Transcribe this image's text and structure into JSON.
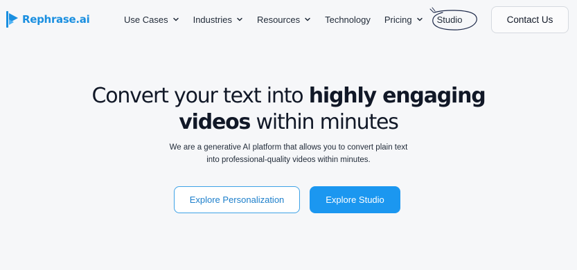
{
  "brand": {
    "name": "Rephrase.ai",
    "logo_icon": "play-flag-icon",
    "color": "#1a8fe0"
  },
  "nav": {
    "items": [
      {
        "label": "Use Cases",
        "has_dropdown": true
      },
      {
        "label": "Industries",
        "has_dropdown": true
      },
      {
        "label": "Resources",
        "has_dropdown": true
      },
      {
        "label": "Technology",
        "has_dropdown": false
      },
      {
        "label": "Pricing",
        "has_dropdown": true
      }
    ],
    "studio_label": "Studio",
    "dropdown_icon": "chevron-down-icon"
  },
  "header": {
    "contact_label": "Contact Us"
  },
  "hero": {
    "title_part1": "Convert your text into ",
    "title_bold1": "highly engaging",
    "title_bold2": "videos",
    "title_part2": " within minutes",
    "subtitle_line1": "We are a generative AI platform that allows you to convert plain text",
    "subtitle_line2": "into professional-quality videos within minutes.",
    "secondary_cta": "Explore Personalization",
    "primary_cta": "Explore Studio"
  },
  "colors": {
    "background": "#f6f7f9",
    "accent": "#1b97f0",
    "outline": "#3ea2e6",
    "text": "#111827"
  }
}
